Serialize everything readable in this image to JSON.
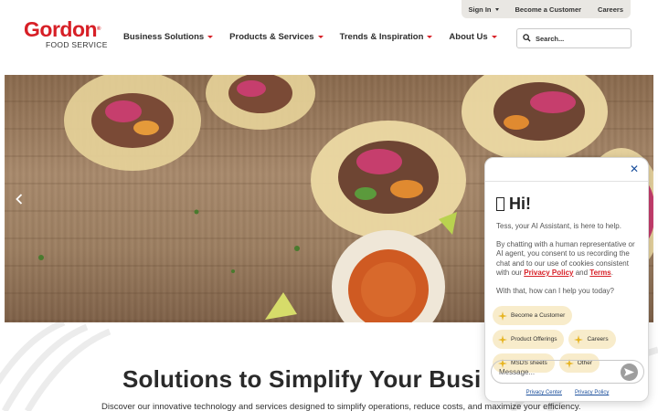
{
  "utility_nav": {
    "sign_in": "Sign In",
    "become_customer": "Become a Customer",
    "careers": "Careers"
  },
  "logo": {
    "brand": "Gordon",
    "tagline": "FOOD SERVICE",
    "registered": "®"
  },
  "main_nav": [
    {
      "label": "Business Solutions"
    },
    {
      "label": "Products & Services"
    },
    {
      "label": "Trends & Inspiration"
    },
    {
      "label": "About Us"
    }
  ],
  "search": {
    "placeholder": "Search..."
  },
  "hero": {
    "previous_icon": "chevron-left-icon"
  },
  "content": {
    "headline": "Solutions to Simplify Your Busi",
    "subline": "Discover our innovative technology and services designed to simplify operations, reduce costs, and maximize your efficiency."
  },
  "chat": {
    "close_label": "✕",
    "greeting": "Hi!",
    "intro": "Tess, your AI Assistant, is here to help.",
    "consent_prefix": "By chatting with a human representative or AI agent, you consent to us recording the chat and to our use of cookies consistent with our ",
    "privacy_link": "Privacy Policy",
    "consent_and": " and ",
    "terms_link": "Terms",
    "consent_suffix": ".",
    "prompt": "With that, how can I help you today?",
    "chips": [
      {
        "label": "Become a Customer"
      },
      {
        "label": "Product Offerings"
      },
      {
        "label": "Careers"
      },
      {
        "label": "MSDS sheets"
      },
      {
        "label": "Other"
      }
    ],
    "input_placeholder": "Message...",
    "footer": {
      "privacy_center": "Privacy Center",
      "privacy_policy": "Privacy Policy"
    }
  },
  "colors": {
    "brand_red": "#d71f26",
    "link_blue": "#1b4f9c",
    "chip_bg": "#f8eccb"
  }
}
